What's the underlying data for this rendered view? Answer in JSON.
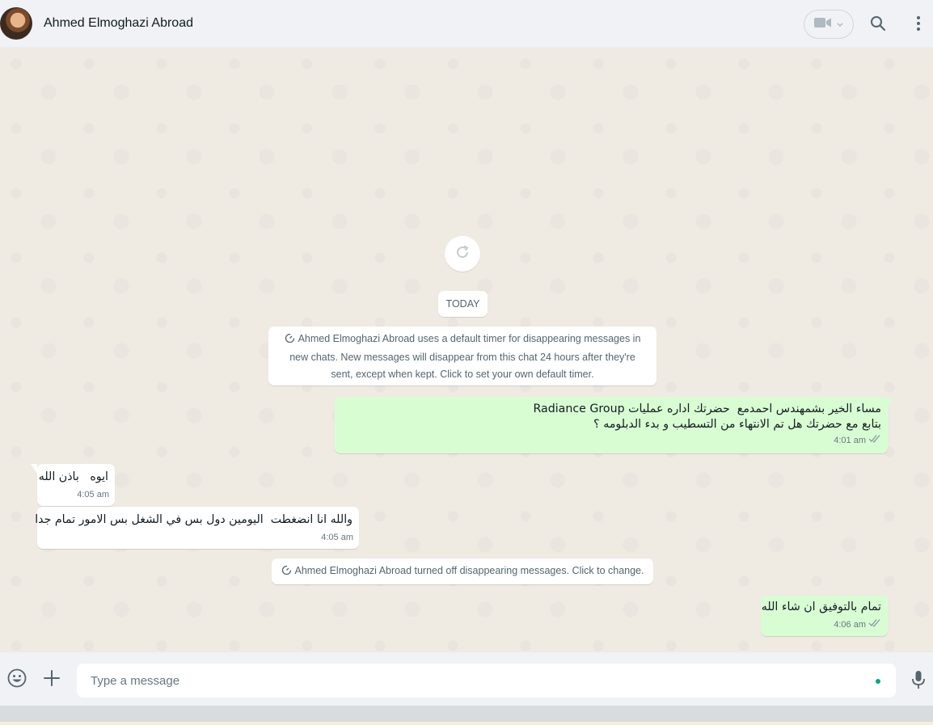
{
  "header": {
    "contact_name": "Ahmed Elmoghazi Abroad",
    "icons": [
      "avatar",
      "video-camera-icon",
      "chevron-down-icon",
      "search-icon",
      "menu-kebab-icon"
    ]
  },
  "chat": {
    "date_divider": "TODAY",
    "system_notice_1": "Ahmed Elmoghazi Abroad uses a default timer for disappearing messages in new chats. New messages will disappear from this chat 24 hours after they're sent, except when kept. Click to set your own default timer.",
    "system_notice_2": "Ahmed Elmoghazi Abroad turned off disappearing messages. Click to change.",
    "messages": [
      {
        "direction": "outgoing",
        "line1": "مساء الخير بشمهندس احمدمع  حضرتك اداره عمليات Radiance Group",
        "line2": "بتابع مع حضرتك هل تم الانتهاء من التسطيب و بدء الدبلومه ؟",
        "time": "4:01 am",
        "status": "read"
      },
      {
        "direction": "incoming",
        "text": "ايوه   باذن الله",
        "time": "4:05 am"
      },
      {
        "direction": "incoming",
        "text": "والله انا انضغطت  اليومين دول بس في الشغل بس الامور تمام جدا",
        "time": "4:05 am"
      },
      {
        "direction": "outgoing",
        "text": "تمام بالتوفيق ان شاء الله",
        "time": "4:06 am",
        "status": "read"
      }
    ]
  },
  "composer": {
    "placeholder": "Type a message"
  },
  "colors": {
    "outgoing_bubble": "#d9fdd3",
    "incoming_bubble": "#ffffff",
    "chat_background": "#efeae2",
    "header_background": "#f0f2f5",
    "read_tick": "#8696a0",
    "accent": "#00a884"
  }
}
